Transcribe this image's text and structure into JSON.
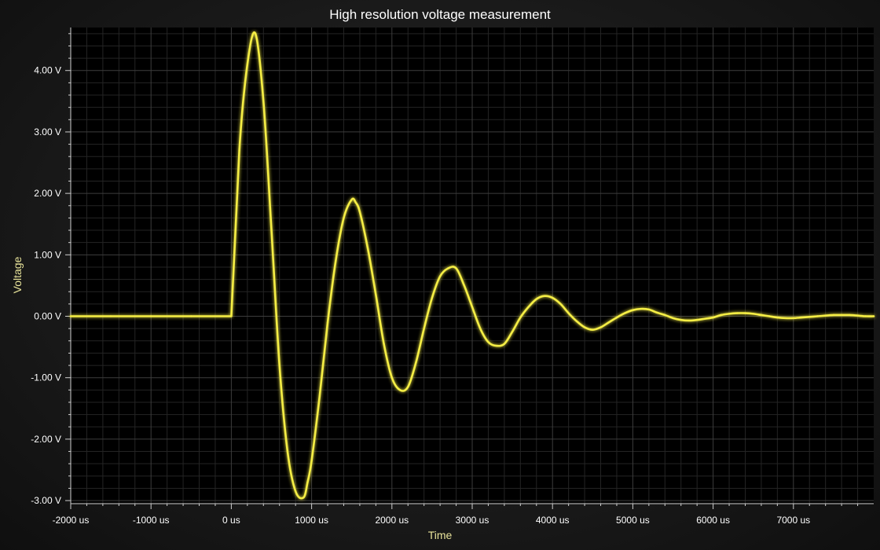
{
  "chart_data": {
    "type": "line",
    "title": "High resolution voltage measurement",
    "xlabel": "Time",
    "ylabel": "Voltage",
    "xlim": [
      -2000,
      8000
    ],
    "ylim": [
      -3.05,
      4.7
    ],
    "x_ticks": [
      -2000,
      -1000,
      0,
      1000,
      2000,
      3000,
      4000,
      5000,
      6000,
      7000
    ],
    "x_tick_labels": [
      "-2000 us",
      "-1000 us",
      "0 us",
      "1000 us",
      "2000 us",
      "3000 us",
      "4000 us",
      "5000 us",
      "6000 us",
      "7000 us"
    ],
    "y_ticks": [
      4,
      3,
      2,
      1,
      0,
      -1,
      -2,
      -3
    ],
    "y_tick_labels": [
      "4.00 V",
      "3.00 V",
      "2.00 V",
      "1.00 V",
      "0.00 V",
      "-1.00 V",
      "-2.00 V",
      "-3.00 V"
    ],
    "grid": true,
    "line_color": "#f5ee45",
    "series": [
      {
        "x": [
          -2000,
          -1500,
          -1000,
          -500,
          0,
          100,
          200,
          300,
          400,
          500,
          600,
          700,
          800,
          900,
          950,
          1000,
          1100,
          1200,
          1300,
          1400,
          1500,
          1550,
          1600,
          1700,
          1800,
          1900,
          2000,
          2100,
          2200,
          2300,
          2400,
          2500,
          2600,
          2700,
          2800,
          2900,
          3000,
          3100,
          3200,
          3300,
          3400,
          3500,
          3600,
          3700,
          3800,
          3900,
          4000,
          4100,
          4200,
          4300,
          4400,
          4500,
          4600,
          4700,
          4800,
          4900,
          5000,
          5100,
          5200,
          5300,
          5400,
          5500,
          5600,
          5700,
          5800,
          5900,
          6000,
          6100,
          6200,
          6300,
          6400,
          6500,
          6600,
          6700,
          6800,
          6900,
          7000,
          7100,
          7200,
          7300,
          7400,
          7500,
          7600,
          7700,
          7800,
          7900,
          8000
        ],
        "values": [
          0.0,
          0.0,
          0.0,
          0.0,
          0.0,
          2.7,
          4.1,
          4.6,
          3.5,
          1.4,
          -0.8,
          -2.2,
          -2.85,
          -2.95,
          -2.7,
          -2.35,
          -1.3,
          -0.1,
          0.9,
          1.6,
          1.9,
          1.85,
          1.7,
          1.1,
          0.35,
          -0.45,
          -1.0,
          -1.2,
          -1.15,
          -0.75,
          -0.2,
          0.3,
          0.65,
          0.78,
          0.78,
          0.5,
          0.15,
          -0.2,
          -0.42,
          -0.48,
          -0.45,
          -0.25,
          -0.02,
          0.15,
          0.28,
          0.33,
          0.3,
          0.2,
          0.05,
          -0.08,
          -0.18,
          -0.22,
          -0.18,
          -0.1,
          -0.02,
          0.05,
          0.1,
          0.12,
          0.11,
          0.06,
          0.02,
          -0.03,
          -0.06,
          -0.07,
          -0.06,
          -0.04,
          -0.02,
          0.02,
          0.04,
          0.05,
          0.05,
          0.04,
          0.02,
          0.0,
          -0.02,
          -0.03,
          -0.03,
          -0.02,
          -0.01,
          0.0,
          0.01,
          0.02,
          0.02,
          0.02,
          0.01,
          0.0,
          0.0
        ]
      }
    ]
  }
}
